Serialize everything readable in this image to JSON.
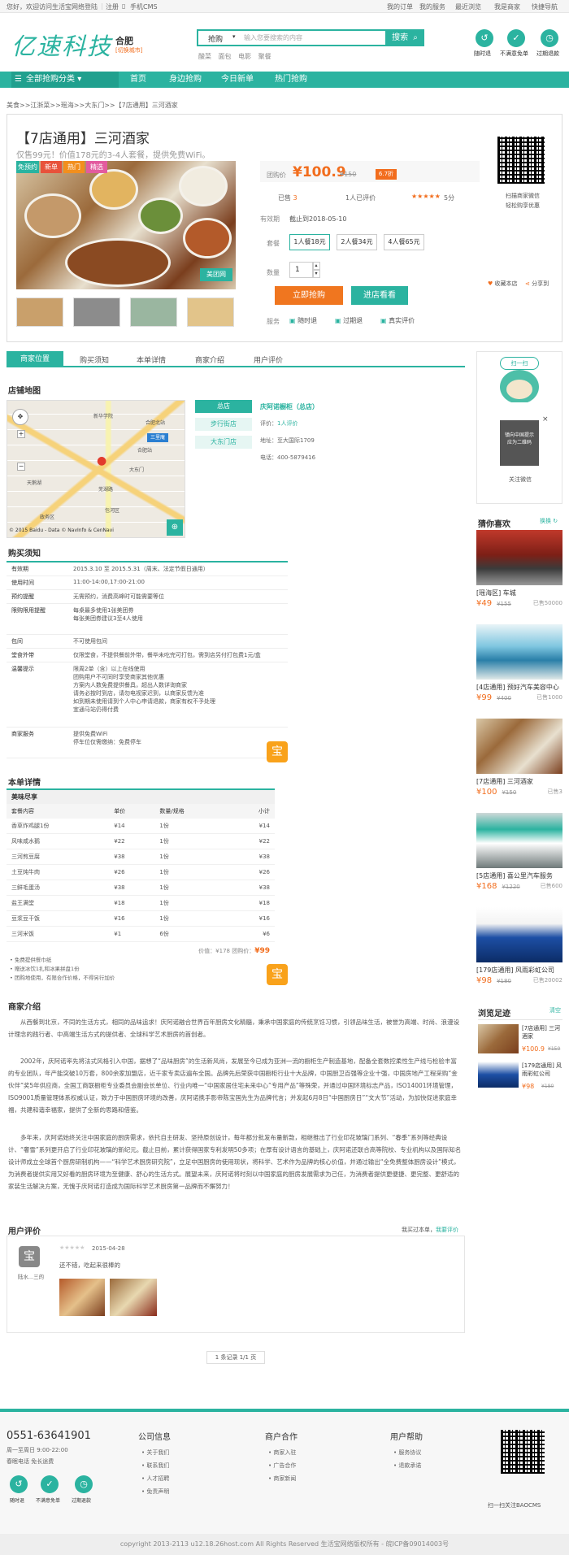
{
  "topbar": {
    "welcome": "您好，欢迎访问生活宝网络",
    "login": "登陆",
    "register": "注册",
    "mobile": "手机CMS",
    "links": [
      "我的订单",
      "我的服务",
      "最近浏览",
      "我是商家",
      "快捷导航"
    ]
  },
  "header": {
    "logo": "亿速科技",
    "city": "合肥",
    "city_switch": "[切换城市]",
    "search_category": "抢购",
    "search_placeholder": "输入您要搜索的内容",
    "search_button": "搜索",
    "hot_words": [
      "酸菜",
      "面包",
      "电影",
      "聚餐"
    ],
    "guarantees": [
      "随时退",
      "不满意免单",
      "过期退款"
    ]
  },
  "nav": {
    "category": "全部抢购分类",
    "items": [
      "首页",
      "身边抢购",
      "今日新单",
      "热门抢购"
    ]
  },
  "breadcrumb": "美食>>江浙菜>>瑶海>>大东门>>【7店通用】三河酒家",
  "product": {
    "title": "【7店通用】三河酒家",
    "subtitle": "仅售99元！价值178元的3-4人套餐，提供免费WiFi。",
    "badges": [
      "免预约",
      "新单",
      "热门",
      "精选"
    ],
    "watermark": "美团网",
    "price_label": "团购价",
    "price": "¥100.9",
    "old_price": "¥150",
    "discount": "6.7折",
    "sold_prefix": "已售",
    "sold_count": "3",
    "review_count": "1人已评价",
    "stars": "★★★★★",
    "score": "5分",
    "valid_label": "有效期",
    "valid_value": "截止到2018-05-10",
    "package_label": "套餐",
    "packages": [
      "1人餐18元",
      "2人餐34元",
      "4人餐65元"
    ],
    "qty_label": "数量",
    "qty": "1",
    "buy_button": "立即抢购",
    "shop_button": "进店看看",
    "service_label": "服务",
    "services": [
      "随时退",
      "过期退",
      "真实评价"
    ],
    "qr_caption_1": "扫描商家微信",
    "qr_caption_2": "轻松购享优惠",
    "favorite": "收藏本店",
    "share": "分享到"
  },
  "tabs": [
    "商家位置",
    "购买须知",
    "本单详情",
    "商家介绍",
    "用户评价"
  ],
  "location": {
    "title": "店铺地图",
    "map_copyright": "© 2015 Baidu - Data © NavInfo & CenNavi",
    "map_places": [
      "新华学院",
      "三里庵",
      "合肥北站",
      "大东门",
      "天鹅湖",
      "芜湖路",
      "合肥站",
      "包河区",
      "政务区"
    ],
    "store_buttons": [
      "总店",
      "步行街店",
      "大东门店"
    ],
    "store_name": "庆阿诺橱柜（总店）",
    "rating_label": "评价：",
    "rating_value": "1人评价",
    "address_label": "地址：",
    "address_value": "至大国际1709",
    "phone_label": "电话：",
    "phone_value": "400-5879416"
  },
  "notice": {
    "title": "购买须知",
    "rows": [
      {
        "k": "有效期",
        "v": "2015.3.10 至 2015.5.31（周末、法定节假日通用）"
      },
      {
        "k": "使用时间",
        "v": "11:00-14:00,17:00-21:00"
      },
      {
        "k": "预约提醒",
        "v": "无需预约，消费高峰时可能需要等位"
      },
      {
        "k": "限购限用提醒",
        "v": "每桌最多使用1张美团券|每张美团券建议3至4人使用"
      },
      {
        "k": "包间",
        "v": "不可使用包间"
      },
      {
        "k": "堂食外带",
        "v": "仅限堂食，不提供餐前外带，餐毕未吃完可打包，需到店另付打包费1元/盒"
      },
      {
        "k": "温馨提示",
        "v": "限周2单（含）以上在线使用|团购用户不可同时享受商家其他优惠|方案内人数免费提供餐具，超出人数详询商家|请务必按时到店，请勿电视家迟到，以商家反馈为准|如到期未使用请到个人中心申请退款，商家有权不予处理|宜通马站仍得付费"
      },
      {
        "k": "商家服务",
        "v": "提供免费WiFi|停车位仅需缴纳：免费停车"
      }
    ]
  },
  "menu": {
    "title": "本单详情",
    "group": "美味尽享",
    "headers": [
      "套餐内容",
      "单价",
      "数量/规格",
      "小计"
    ],
    "rows": [
      [
        "香草炸鸡腿1份",
        "¥14",
        "1份",
        "¥14"
      ],
      [
        "风味咸水鹅",
        "¥22",
        "1份",
        "¥22"
      ],
      [
        "三河煎豆腐",
        "¥38",
        "1份",
        "¥38"
      ],
      [
        "土豆炖牛肉",
        "¥26",
        "1份",
        "¥26"
      ],
      [
        "三鲜毛蛋汤",
        "¥38",
        "1份",
        "¥38"
      ],
      [
        "盐王满堂",
        "¥18",
        "1份",
        "¥18"
      ],
      [
        "豆浆豆干饭",
        "¥16",
        "1份",
        "¥16"
      ],
      [
        "三河米饭",
        "¥1",
        "6份",
        "¥6"
      ]
    ],
    "total_label": "价值：¥178  团购价：",
    "total_price": "¥99",
    "notes": [
      "免费提供餐巾纸",
      "赠送冰饮1扎和冰果拼盘1份",
      "团购地使用，有限合作价格，不得另行加价"
    ]
  },
  "intro": {
    "title": "商家介绍",
    "paragraphs": [
      "从西餐到北京，不同的生活方式，相同的品味追求！庆阿诺融合世界百年厨房文化精髓，秉承中国家庭的传统烹饪习惯，引领品味生活，被誉为高端、时尚、浪漫设计理念的践行者、中高端生活方式的提供者、全球科学艺术厨房的首创者。",
      "2002年，庆阿诺率先将法式风格引入中国，据想了“品味厨房”的生活新风尚，发展至今已成为亚洲一流的橱柜生产制造基地，配备全套数控柔性生产线与检验丰富的专业团队，年产能突破10万套，800余家加盟店，近千家专卖店遍布全国。品牌先后荣获中国橱柜行业十大品牌，中国厨卫百强等企业十强，中国房地产工程采购“金伙伴”奖5年供应商，全国工商联橱柜专业委员会副会长单位、行业内唯一“中国家居住宅未来中心”专用产品”等殊荣，并通过中国环境标志产品，ISO14001环境管理，ISO9001质量管理体系权威认证，致力于中国厨房环境的改善，庆阿诺携手影帝陈宝国先生为品牌代言；并发起6月8日“中国厨房日”“文大节”活动，为加快促进家庭幸福，共建和谐幸福家，提供了全新的思路和借鉴。",
      "多年来，庆阿诺始终关注中国家庭的厨房需求，依托自主研发、坚持原创设计，每年都分批发布量新款，相继推出了行业印花玻璃门系列、“春季”系列等经典设计、“奢雪”系列更开启了行业印花玻璃的新纪元。截止目前，累计获得国家专利发明50多项；在厚有设计语言的基础上，庆阿诺还联合高等院校、专业机构以及国际知名设计师成立全球首个厨房研制机构——“科学艺术厨房研究院”，立足中国厨房的使用现状，将科学、艺术作为品牌的核心价值，并通过输出“全免费整体厨房设计”模式，为消费者提供实用又好看的厨房环境为至健康、舒心的生活方式。展望未来，庆阿诺将时刻以中国家庭的厨房发展需求为己任，为消费者提供更便捷、更完整、更舒适的家装生活解决方案，无愧于庆阿诺打造成为国际科学艺术厨房第一品牌而不懈努力！"
    ]
  },
  "reviews": {
    "title": "用户评价",
    "bought_prompt": "我买过本单，",
    "write_link": "我要评价",
    "user": "陆水...三的",
    "date": "2015-04-28",
    "stars": "★★★★★",
    "text": "还不错，吃起来很棒的",
    "pagination": "1 条记录 1/1 页"
  },
  "sidebar": {
    "scan_title": "扫一扫",
    "scan_note": "镇向中国提示\n应为二维码",
    "scan_caption": "关注微信",
    "guess_title": "猜你喜欢",
    "swap": "换换",
    "guess_items": [
      {
        "name": "[瑶海区] 车城",
        "price": "¥49",
        "old": "¥155",
        "sold": "已售50000"
      },
      {
        "name": "[4店通用] 预好汽车美容中心",
        "price": "¥99",
        "old": "¥400",
        "sold": "已售1000"
      },
      {
        "name": "[7店通用] 三河酒家",
        "price": "¥100",
        "old": "¥150",
        "sold": "已售3"
      },
      {
        "name": "[5店通用] 喜公里汽车服务",
        "price": "¥168",
        "old": "¥1220",
        "sold": "已售600"
      },
      {
        "name": "[179店通用] 风雨彩虹公司",
        "price": "¥98",
        "old": "¥180",
        "sold": "已售20002"
      }
    ],
    "history_title": "浏览足迹",
    "clear": "清空",
    "history_items": [
      {
        "name": "[7店通用] 三河酒家",
        "price": "¥100.9",
        "old": "¥150"
      },
      {
        "name": "[179店通用] 风雨彩虹公司",
        "price": "¥98",
        "old": "¥180"
      }
    ]
  },
  "footer": {
    "phone": "0551-63641901",
    "hours": "周一至周日 9:00-22:00",
    "note": "春眠电话 免长途费",
    "guarantees": [
      "随时退",
      "不满意免单",
      "过期退款"
    ],
    "cols": [
      {
        "title": "公司信息",
        "items": [
          "关于我们",
          "联系我们",
          "人才招聘",
          "免责声明"
        ]
      },
      {
        "title": "商户合作",
        "items": [
          "商家入驻",
          "广告合作",
          "商家新闻"
        ]
      },
      {
        "title": "用户帮助",
        "items": [
          "服务协议",
          "退款承诺"
        ]
      }
    ],
    "qr_caption": "扫一扫关注BAOCMS",
    "copyright": "copyright 2013-2113 u12.18.26host.com All Rights Reserved 生活宝网络版权所有 - 皖ICP备09014003号"
  },
  "colors": {
    "accent": "#2bb3a0",
    "price": "#f26d1d"
  }
}
